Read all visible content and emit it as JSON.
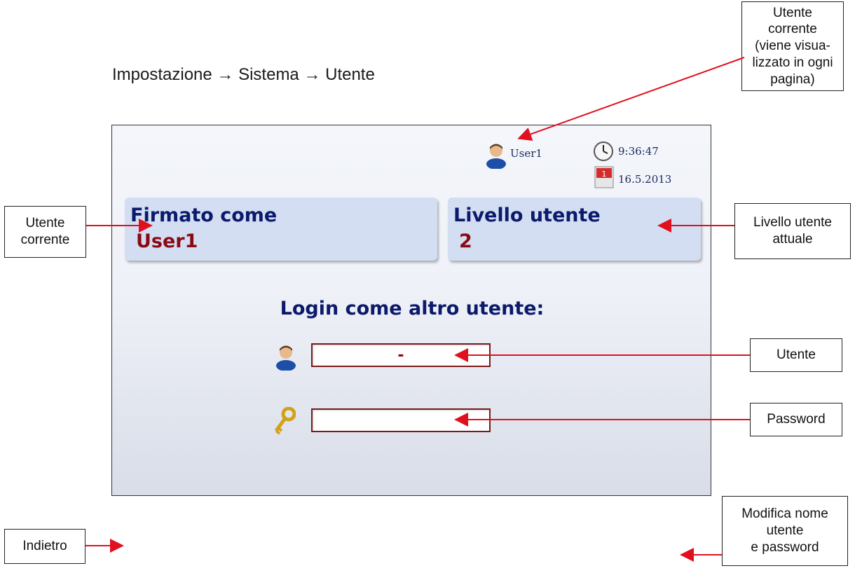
{
  "breadcrumb": "Impostazione → Sistema → Utente",
  "status": {
    "user": "User1",
    "time": "9:36:47",
    "date": "16.5.2013"
  },
  "panels": {
    "signed_title": "Firmato come",
    "signed_value": "User1",
    "level_title": "Livello utente",
    "level_value": "2"
  },
  "login": {
    "title": "Login come altro utente:",
    "user_value": "-",
    "password_value": ""
  },
  "callouts": {
    "current_user_top": "Utente\ncorrente\n(viene visua-\nlizzato in ogni\npagina)",
    "current_user_left": "Utente\ncorrente",
    "user_level": "Livello utente\nattuale",
    "user": "Utente",
    "password": "Password",
    "back": "Indietro",
    "change": "Modifica nome\nutente\ne password"
  },
  "colors": {
    "arrow": "#e0101e",
    "panel": "#d3def3",
    "title": "#0b1a6b",
    "value": "#8a0a14"
  }
}
